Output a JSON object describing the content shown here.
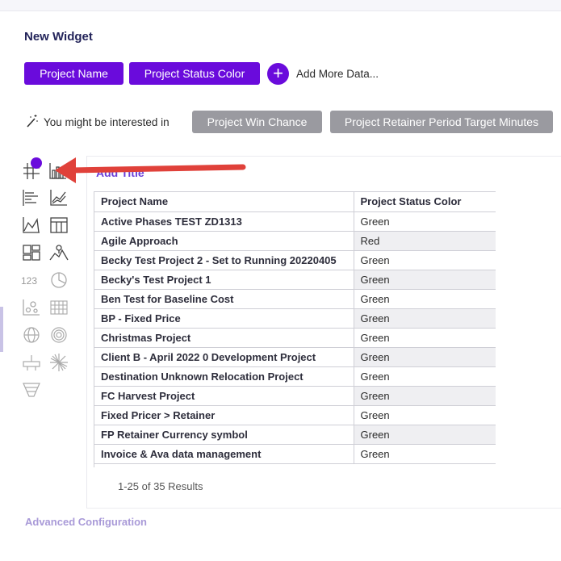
{
  "header": {
    "title": "New Widget"
  },
  "data_fields": [
    {
      "label": "Project Name"
    },
    {
      "label": "Project Status Color"
    }
  ],
  "add_more": {
    "icon": "plus-icon",
    "glyph": "+",
    "label": "Add More Data..."
  },
  "suggestions": {
    "intro": "You might be interested in",
    "items": [
      {
        "label": "Project Win Chance"
      },
      {
        "label": "Project Retainer Period Target Minutes"
      }
    ]
  },
  "chart_types": {
    "items": [
      "grid-table-icon",
      "bar-chart-icon",
      "horizontal-bar-icon",
      "line-chart-icon",
      "area-chart-icon",
      "table-icon",
      "card-layout-icon",
      "map-icon",
      "number-icon",
      "pie-chart-icon",
      "scatter-icon",
      "heatmap-icon",
      "globe-icon",
      "gauge-icon",
      "hierarchy-icon",
      "sunburst-icon",
      "funnel-icon"
    ],
    "number_label": "123"
  },
  "preview": {
    "title_placeholder": "Add Title",
    "table": {
      "columns": [
        "Project Name",
        "Project Status Color"
      ],
      "rows": [
        [
          "Active Phases TEST ZD1313",
          "Green"
        ],
        [
          "Agile Approach",
          "Red"
        ],
        [
          "Becky Test Project 2 - Set to Running 20220405",
          "Green"
        ],
        [
          "Becky's Test Project 1",
          "Green"
        ],
        [
          "Ben Test for Baseline Cost",
          "Green"
        ],
        [
          "BP - Fixed Price",
          "Green"
        ],
        [
          "Christmas Project",
          "Green"
        ],
        [
          "Client B - April 2022 0 Development Project",
          "Green"
        ],
        [
          "Destination Unknown Relocation Project",
          "Green"
        ],
        [
          "FC Harvest Project",
          "Green"
        ],
        [
          "Fixed Pricer > Retainer",
          "Green"
        ],
        [
          "FP Retainer Currency symbol",
          "Green"
        ],
        [
          "Invoice & Ava data management",
          "Green"
        ]
      ]
    },
    "results_text": "1-25 of 35 Results"
  },
  "footer": {
    "advanced_label": "Advanced Configuration"
  },
  "colors": {
    "accent": "#6a0bdc",
    "suggestion_bg": "#9a9aa0",
    "arrow": "#e0413a",
    "link": "#a99ad8"
  }
}
